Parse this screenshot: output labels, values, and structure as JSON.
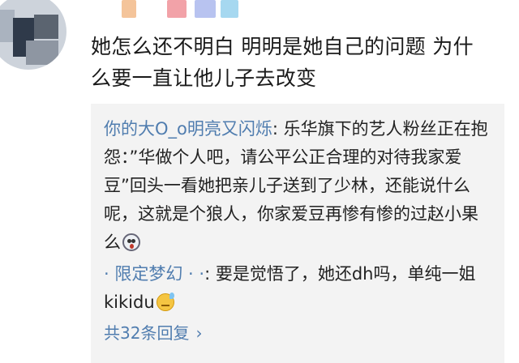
{
  "comment": {
    "text_line1": "她怎么还不明白 明明是她自己的问题 为什",
    "text_line2": "么要一直让他儿子去改变"
  },
  "replies": [
    {
      "username": "你的大O_o明亮又闪烁",
      "separator": ": ",
      "text": "乐华旗下的艺人粉丝正在抱怨：”华做个人吧，请公平公正合理的对待我家爱豆”回头一看她把亲儿子送到了少林，还能说什么呢，这就是个狼人，你家爱豆再惨有惨的过赵小果么",
      "emoji": "surprised-face-icon"
    },
    {
      "username": "· 限定梦幻 · ·",
      "separator": ": ",
      "text": "要是觉悟了，她还dh吗，单纯一姐kikidu",
      "emoji": "sweat-smile-icon"
    }
  ],
  "more_replies": {
    "label": "共32条回复",
    "chevron": "›"
  },
  "colors": {
    "username": "#507daf",
    "reply_bg": "#f3f3f3",
    "text": "#1a1a1a"
  }
}
